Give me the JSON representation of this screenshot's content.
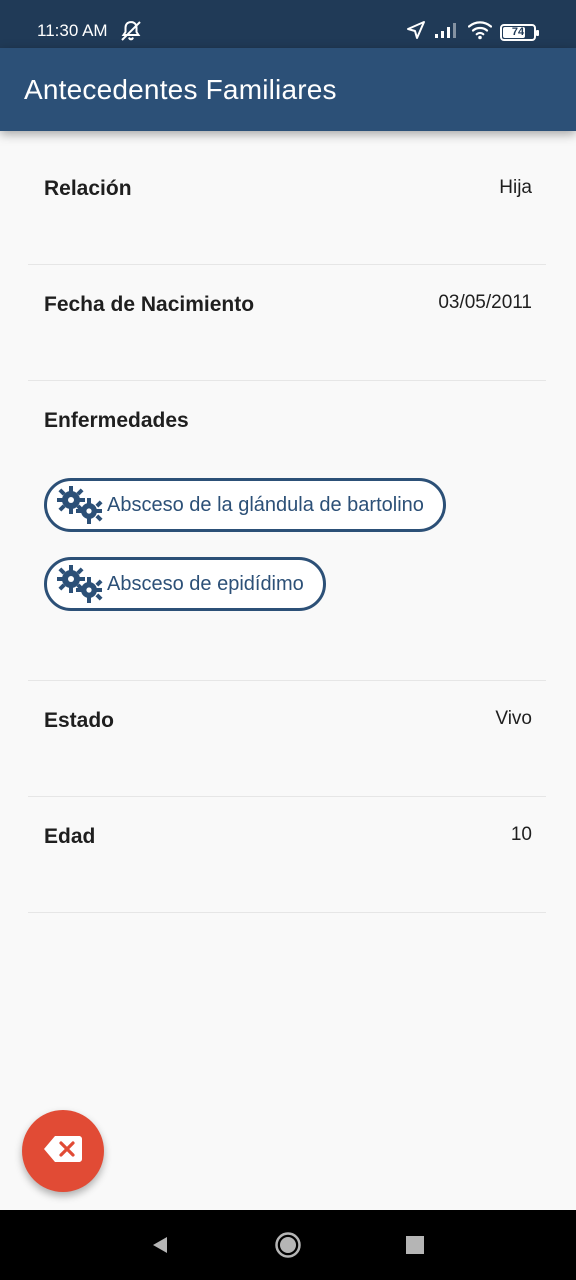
{
  "status_bar": {
    "time": "11:30 AM",
    "battery_level": "74",
    "icons": [
      "mute-bell-icon",
      "location-arrow-icon",
      "signal-icon",
      "wifi-icon",
      "battery-icon"
    ]
  },
  "app_bar": {
    "title": "Antecedentes Familiares"
  },
  "details": {
    "relation_label": "Relación",
    "relation_value": "Hija",
    "birth_label": "Fecha de Nacimiento",
    "birth_value": "03/05/2011",
    "diseases_label": "Enfermedades",
    "diseases": [
      {
        "label": "Absceso de la glándula de bartolino",
        "icon": "virus-icon"
      },
      {
        "label": "Absceso de epidídimo",
        "icon": "virus-icon"
      }
    ],
    "status_label": "Estado",
    "status_value": "Vivo",
    "age_label": "Edad",
    "age_value": "10"
  },
  "fab": {
    "icon": "backspace-icon"
  },
  "nav_bar": {
    "icons": [
      "back-icon",
      "home-icon",
      "recents-icon"
    ]
  },
  "colors": {
    "status_bar": "#203a57",
    "app_bar": "#2c5077",
    "accent": "#2c5077",
    "fab": "#e14b35",
    "background": "#f9f9f9"
  }
}
